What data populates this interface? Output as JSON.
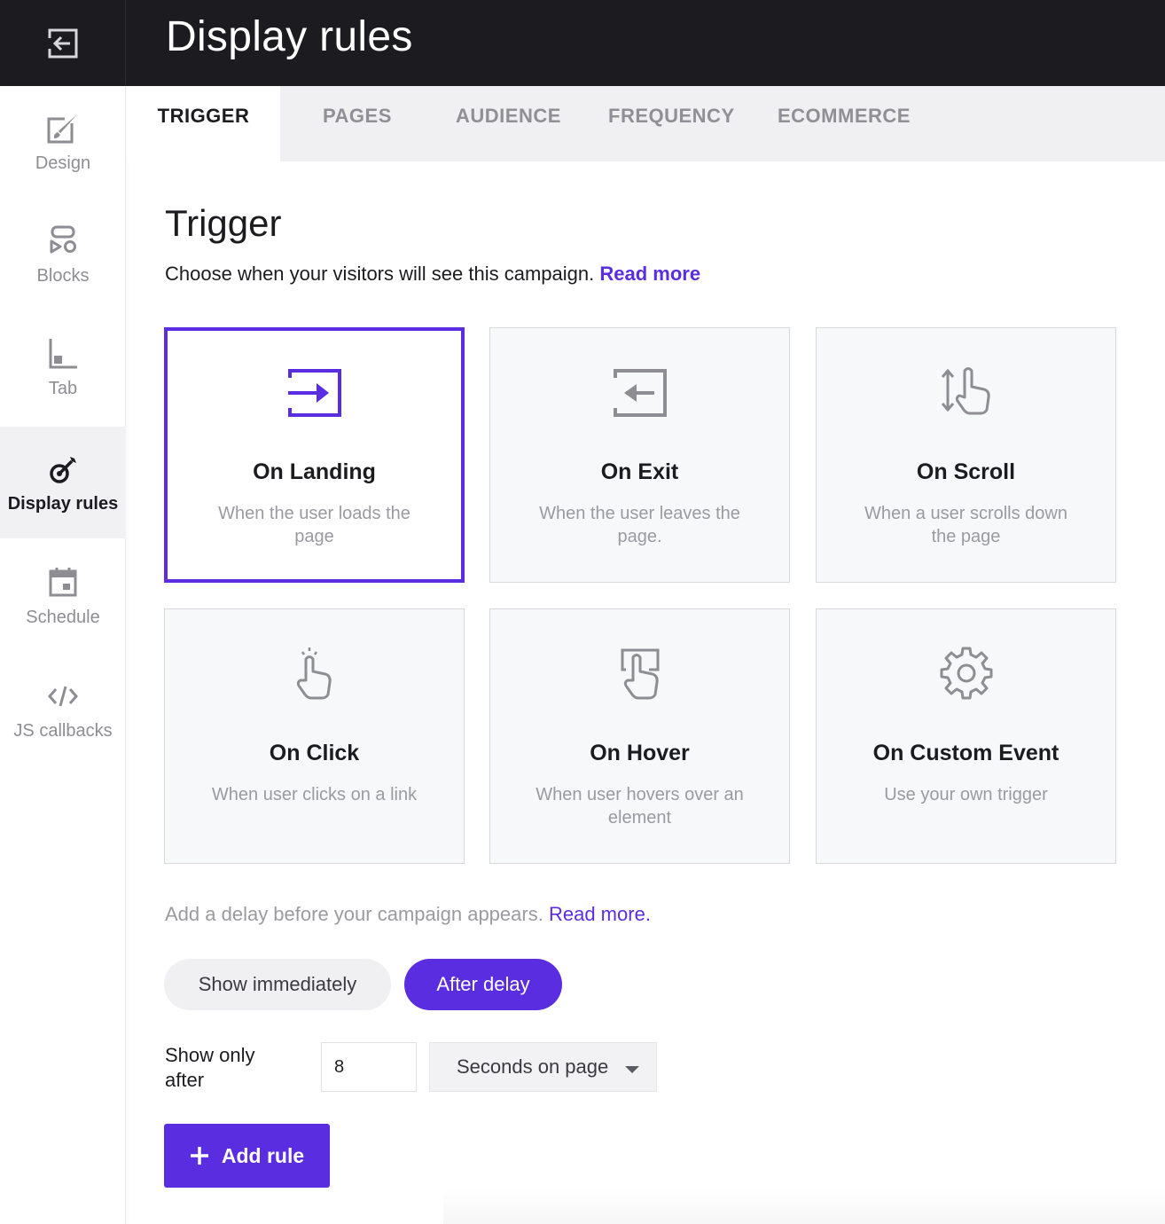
{
  "header": {
    "title": "Display rules",
    "back_icon": "exit-arrow-icon"
  },
  "sidebar": {
    "items": [
      {
        "label": "Design",
        "icon": "paintbrush-icon"
      },
      {
        "label": "Blocks",
        "icon": "blocks-icon"
      },
      {
        "label": "Tab",
        "icon": "tab-icon"
      },
      {
        "label": "Display rules",
        "icon": "target-icon",
        "active": true
      },
      {
        "label": "Schedule",
        "icon": "calendar-icon"
      },
      {
        "label": "JS callbacks",
        "icon": "code-icon"
      }
    ]
  },
  "tabs": [
    {
      "label": "TRIGGER",
      "active": true
    },
    {
      "label": "PAGES"
    },
    {
      "label": "AUDIENCE"
    },
    {
      "label": "FREQUENCY"
    },
    {
      "label": "ECOMMERCE"
    }
  ],
  "trigger": {
    "heading": "Trigger",
    "description": "Choose when your visitors will see this campaign.",
    "read_more": "Read more",
    "cards": [
      {
        "title": "On Landing",
        "description": "When the user loads the page",
        "icon": "enter-icon",
        "selected": true
      },
      {
        "title": "On Exit",
        "description": "When the user leaves the page.",
        "icon": "exit-icon"
      },
      {
        "title": "On Scroll",
        "description": "When a user scrolls down the page",
        "icon": "scroll-hand-icon"
      },
      {
        "title": "On Click",
        "description": "When user clicks on a link",
        "icon": "click-hand-icon"
      },
      {
        "title": "On Hover",
        "description": "When user hovers over an element",
        "icon": "hover-hand-icon"
      },
      {
        "title": "On Custom Event",
        "description": "Use your own trigger",
        "icon": "gear-icon"
      }
    ]
  },
  "delay": {
    "description": "Add a delay before your campaign appears.",
    "read_more": "Read more",
    "period": ".",
    "options": {
      "immediate": "Show immediately",
      "after": "After delay"
    },
    "selected": "after",
    "show_only_after_label": "Show only after",
    "value": "8",
    "unit": "Seconds on page"
  },
  "actions": {
    "add_rule": "Add rule"
  },
  "colors": {
    "accent": "#5b2de0",
    "topbar": "#1c1b1f"
  }
}
